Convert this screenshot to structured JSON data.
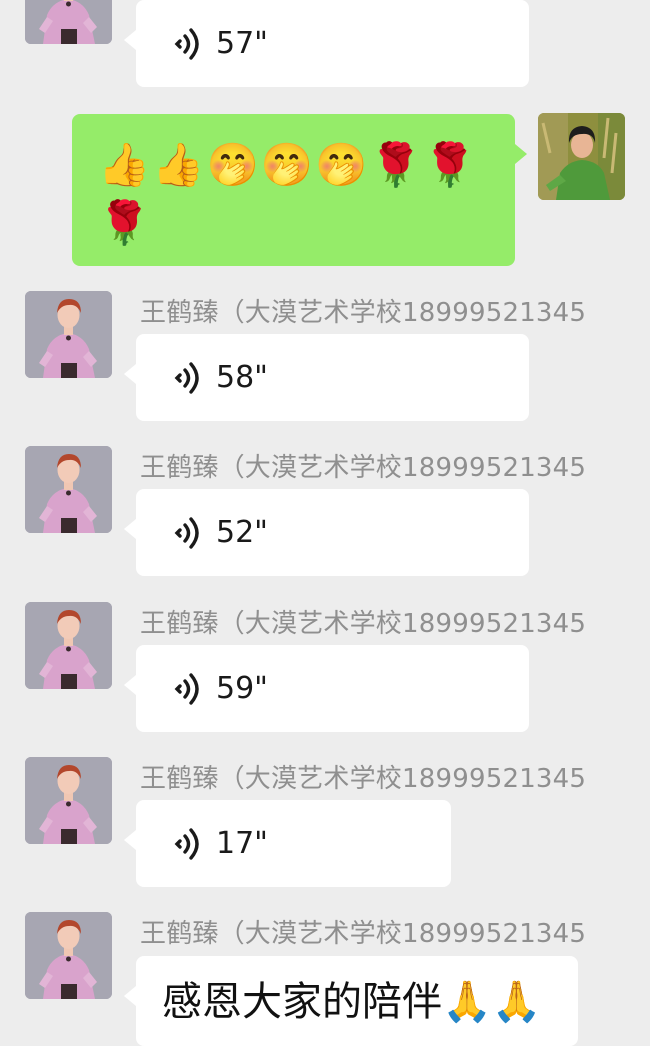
{
  "messages": [
    {
      "sender_name": "",
      "duration": "57\""
    },
    {
      "emoji_line1": "👍👍🤭🤭🤭🌹🌹",
      "emoji_line2": "🌹"
    },
    {
      "sender_name": "王鹤臻（大漠艺术学校18999521345",
      "duration": "58\""
    },
    {
      "sender_name": "王鹤臻（大漠艺术学校18999521345",
      "duration": "52\""
    },
    {
      "sender_name": "王鹤臻（大漠艺术学校18999521345",
      "duration": "59\""
    },
    {
      "sender_name": "王鹤臻（大漠艺术学校18999521345",
      "duration": "17\""
    },
    {
      "sender_name": "王鹤臻（大漠艺术学校18999521345",
      "text": "感恩大家的陪伴🙏🙏"
    }
  ],
  "colors": {
    "background": "#ededed",
    "incoming_bubble": "#ffffff",
    "outgoing_bubble": "#95ec69",
    "sender_name": "#8f8f8f"
  },
  "icons": {
    "voice": "voice-wave-icon",
    "avatar_other": "woman-pink-dress-avatar",
    "avatar_self": "woman-green-outdoor-avatar"
  }
}
